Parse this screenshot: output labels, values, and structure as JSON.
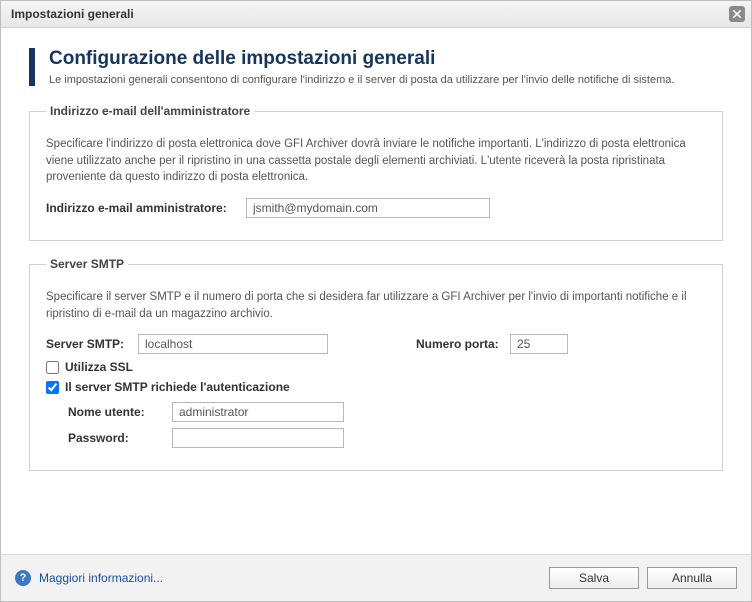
{
  "window": {
    "title": "Impostazioni generali"
  },
  "header": {
    "title": "Configurazione delle impostazioni generali",
    "subtitle": "Le impostazioni generali consentono di configurare l'indirizzo e il server di posta da utilizzare per l'invio delle notifiche di sistema."
  },
  "adminEmail": {
    "legend": "Indirizzo e-mail dell'amministratore",
    "description": "Specificare l'indirizzo di posta elettronica dove GFI Archiver dovrà inviare le notifiche importanti. L'indirizzo di posta elettronica viene utilizzato anche per il ripristino in una cassetta postale degli elementi archiviati. L'utente riceverà la posta ripristinata proveniente da questo indirizzo di posta elettronica.",
    "label": "Indirizzo e-mail amministratore:",
    "value": "jsmith@mydomain.com"
  },
  "smtp": {
    "legend": "Server SMTP",
    "description": "Specificare il server SMTP e il numero di porta che si desidera far utilizzare a GFI Archiver per l'invio di importanti notifiche e il ripristino di e-mail da un magazzino archivio.",
    "serverLabel": "Server SMTP:",
    "serverValue": "localhost",
    "portLabel": "Numero porta:",
    "portValue": "25",
    "useSSL": {
      "label": "Utilizza SSL",
      "checked": false
    },
    "requiresAuth": {
      "label": "Il server SMTP richiede l'autenticazione",
      "checked": true
    },
    "auth": {
      "usernameLabel": "Nome utente:",
      "usernameValue": "administrator",
      "passwordLabel": "Password:",
      "passwordValue": ""
    }
  },
  "footer": {
    "moreInfo": "Maggiori informazioni...",
    "save": "Salva",
    "cancel": "Annulla"
  }
}
